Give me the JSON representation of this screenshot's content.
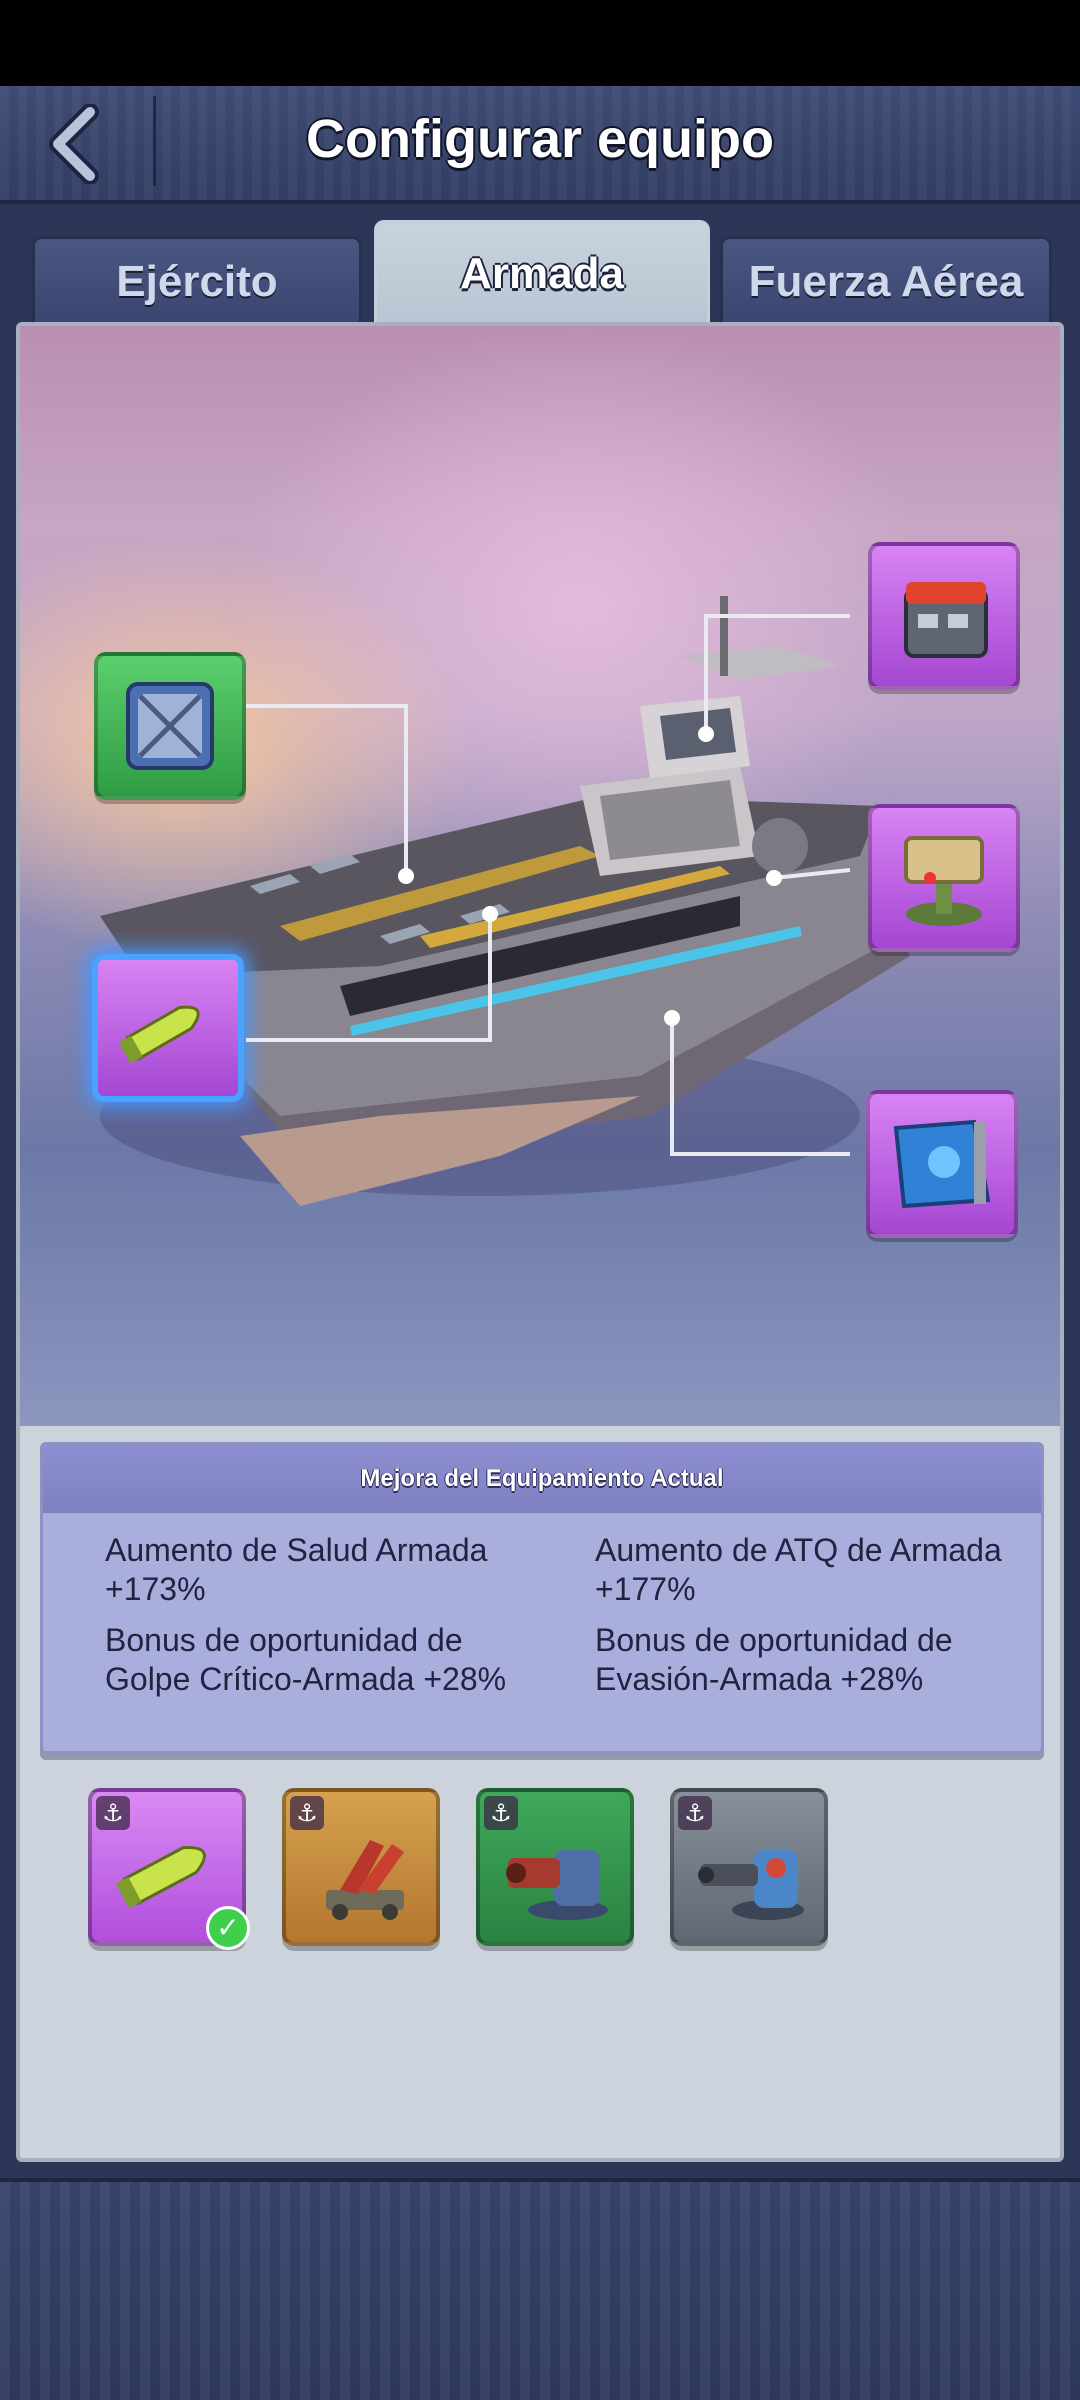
{
  "header": {
    "title": "Configurar equipo"
  },
  "tabs": [
    {
      "label": "Ejército",
      "active": false
    },
    {
      "label": "Armada",
      "active": true
    },
    {
      "label": "Fuerza Aérea",
      "active": false
    }
  ],
  "equipment_slots": [
    {
      "icon": "armor-plate-icon",
      "rarity": "green"
    },
    {
      "icon": "shell-icon",
      "rarity": "purple",
      "selected": true
    },
    {
      "icon": "radar-box-icon",
      "rarity": "purple"
    },
    {
      "icon": "radar-dish-icon",
      "rarity": "purple"
    },
    {
      "icon": "blueprint-map-icon",
      "rarity": "purple"
    }
  ],
  "stats": {
    "header": "Mejora del Equipamiento Actual",
    "items": [
      "Aumento de Salud Armada +173%",
      "Aumento de ATQ de Armada +177%",
      "Bonus de oportunidad de Golpe Crítico-Armada +28%",
      "Bonus de oportunidad de Evasión-Armada +28%"
    ]
  },
  "inventory": [
    {
      "icon": "shell-icon",
      "rarity": "purple",
      "equipped": true
    },
    {
      "icon": "missile-launcher-icon",
      "rarity": "orange",
      "equipped": false
    },
    {
      "icon": "gatling-turret-icon",
      "rarity": "green",
      "equipped": false
    },
    {
      "icon": "cannon-turret-icon",
      "rarity": "gray",
      "equipped": false
    }
  ],
  "colors": {
    "selected_glow": "#4aa3ff",
    "purple_rarity": "#b14fdc",
    "green_rarity": "#2f9c44",
    "orange_rarity": "#b3772e",
    "gray_rarity": "#5f6773"
  }
}
